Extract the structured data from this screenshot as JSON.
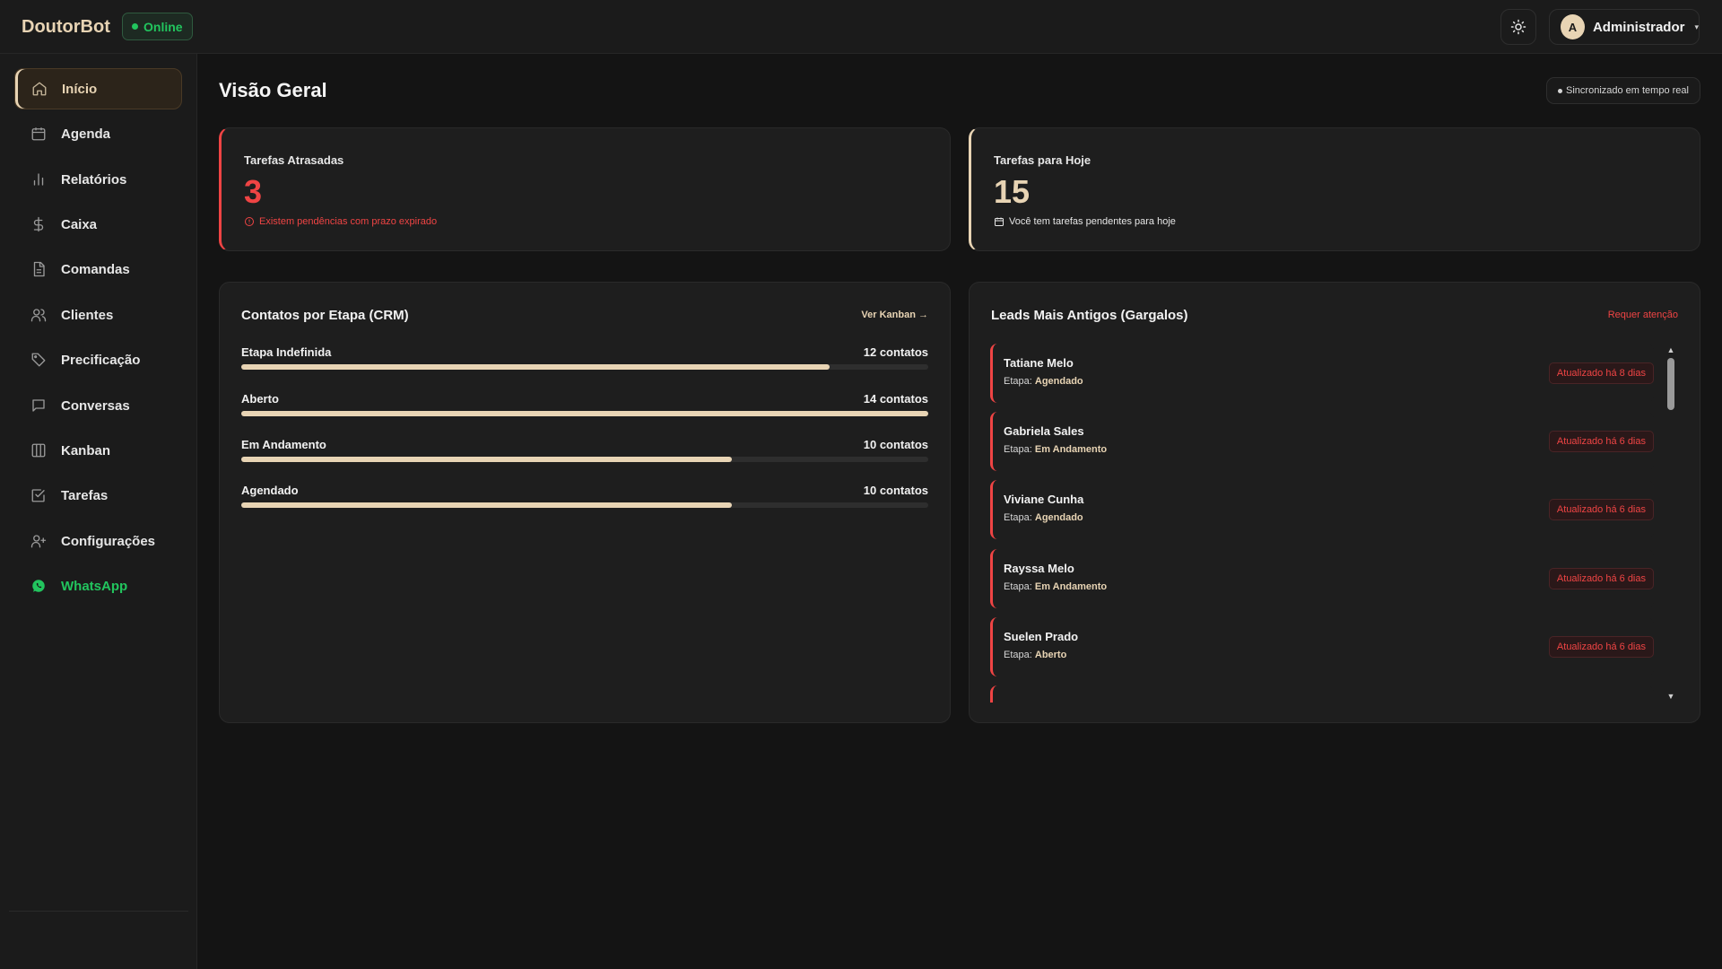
{
  "app": {
    "brand": "DoutorBot",
    "status": "Online"
  },
  "user": {
    "initial": "A",
    "name": "Administrador",
    "caret": "▾"
  },
  "sidebar": {
    "items": [
      {
        "label": "Início",
        "icon": "home-icon"
      },
      {
        "label": "Agenda",
        "icon": "calendar-icon"
      },
      {
        "label": "Relatórios",
        "icon": "bar-chart-icon"
      },
      {
        "label": "Caixa",
        "icon": "dollar-icon"
      },
      {
        "label": "Comandas",
        "icon": "file-icon"
      },
      {
        "label": "Clientes",
        "icon": "users-icon"
      },
      {
        "label": "Precificação",
        "icon": "tag-icon"
      },
      {
        "label": "Conversas",
        "icon": "chat-icon"
      },
      {
        "label": "Kanban",
        "icon": "columns-icon"
      },
      {
        "label": "Tarefas",
        "icon": "check-square-icon"
      },
      {
        "label": "Configurações",
        "icon": "user-plus-icon"
      },
      {
        "label": "WhatsApp",
        "icon": "whatsapp-icon"
      }
    ]
  },
  "main": {
    "title": "Visão Geral",
    "sync": "Sincronizado em tempo real",
    "kpis": {
      "late": {
        "label": "Tarefas Atrasadas",
        "value": "3",
        "note": "Existem pendências com prazo expirado"
      },
      "today": {
        "label": "Tarefas para Hoje",
        "value": "15",
        "note": "Você tem tarefas pendentes para hoje"
      }
    },
    "crm": {
      "title": "Contatos por Etapa (CRM)",
      "link": "Ver Kanban →",
      "stages": [
        {
          "name": "Etapa Indefinida",
          "count": "12 contatos",
          "fraction": 0.857
        },
        {
          "name": "Aberto",
          "count": "14 contatos",
          "fraction": 1.0
        },
        {
          "name": "Em Andamento",
          "count": "10 contatos",
          "fraction": 0.714
        },
        {
          "name": "Agendado",
          "count": "10 contatos",
          "fraction": 0.714
        }
      ]
    },
    "leads": {
      "title": "Leads Mais Antigos (Gargalos)",
      "link": "Requer atenção",
      "stage_prefix": "Etapa:",
      "items": [
        {
          "name": "Tatiane Melo",
          "stage": "Agendado",
          "badge": "Atualizado há 8 dias"
        },
        {
          "name": "Gabriela Sales",
          "stage": "Em Andamento",
          "badge": "Atualizado há 6 dias"
        },
        {
          "name": "Viviane Cunha",
          "stage": "Agendado",
          "badge": "Atualizado há 6 dias"
        },
        {
          "name": "Rayssa Melo",
          "stage": "Em Andamento",
          "badge": "Atualizado há 6 dias"
        },
        {
          "name": "Suelen Prado",
          "stage": "Aberto",
          "badge": "Atualizado há 6 dias"
        }
      ]
    }
  },
  "colors": {
    "accent": "#e8d4b4",
    "danger": "#ef4444",
    "success": "#22c55e",
    "background": "#141414"
  }
}
